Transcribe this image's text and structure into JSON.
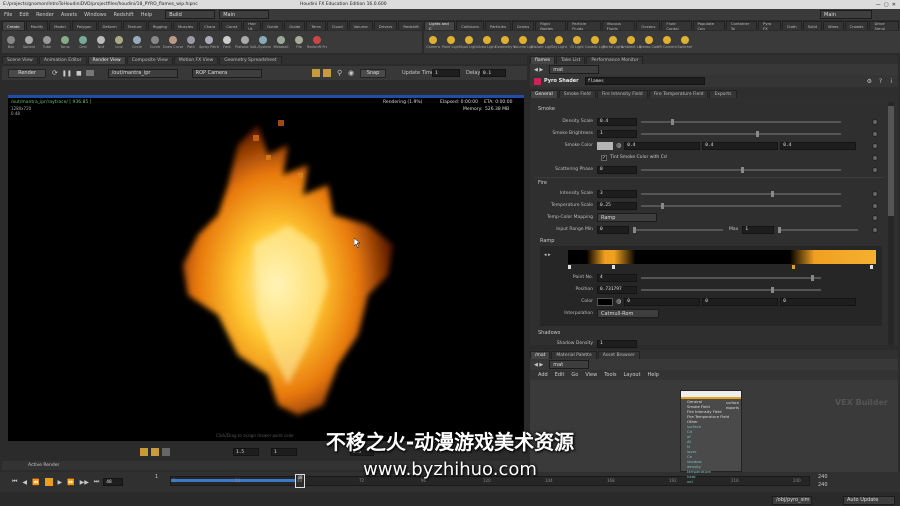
{
  "titlebar": {
    "path": "E:/projects/gnomon/IntroToHoudiniDVD/projectfiles/houdini/18_PYRO_flames_wip.hipnc",
    "app": "Houdini FX Education Edition 16.0.600"
  },
  "menubar": {
    "items": [
      "File",
      "Edit",
      "Render",
      "Assets",
      "Windows",
      "Redshift",
      "Help"
    ],
    "desktop": "Build",
    "context": "Main",
    "right_desktop": "Main"
  },
  "shelf_tabs_left": [
    "Create",
    "Modify",
    "Model",
    "Polygon",
    "Deform",
    "Texture",
    "Rigging",
    "Muscles",
    "Chara",
    "Const",
    "Hair Ut",
    "Guide",
    "Guide",
    "Terra",
    "Cloud",
    "Volume",
    "Drivers",
    "Redshift"
  ],
  "shelf_tools_left": [
    "Box",
    "Sphere",
    "Tube",
    "Torus",
    "Grid",
    "Null",
    "Line",
    "Circle",
    "Curve",
    "Draw Curve",
    "Path",
    "Spray Paint",
    "Font",
    "Platonic Solids",
    "L-System",
    "Metaball",
    "File",
    "Redshift Proxy"
  ],
  "shelf_tabs_right": [
    "Lights and C",
    "Collisions",
    "Particles",
    "Grains",
    "Rigid Bodies",
    "Particle Fluids",
    "Viscous Fluids",
    "Oceans",
    "Fluid Contai",
    "Populate Con",
    "Container To",
    "Pyro FX",
    "Cloth",
    "Solid",
    "Wires",
    "Crowds",
    "Drive Simul"
  ],
  "shelf_tools_right": [
    "Camera",
    "Point Light",
    "Spot Light",
    "Area Light",
    "Geometry Light",
    "Volume Light",
    "Distant Light",
    "Sky Light",
    "GI Light",
    "Caustic Light",
    "Portal Light",
    "Ambient Light",
    "Stereo Camera",
    "VR Camera",
    "Switcher"
  ],
  "viewer": {
    "tabs": [
      "Scene View",
      "Animation Editor",
      "Render View",
      "Composite View",
      "Motion FX View",
      "Geometry Spreadsheet"
    ],
    "render_btn": "Render",
    "out_path": "/out/mantra_ipr",
    "camera": "ROP Camera",
    "snapshot": "Snap",
    "update_time_label": "Update Time",
    "update_time": "1",
    "delay_label": "Delay",
    "delay": "0.1",
    "node_path": "/out/mantra_ipr/raytrace/ [ 936.85 ]",
    "resolution": "1280x720",
    "zoom": "0.48",
    "status": "Rendering (1.9%)",
    "elapsed": "Elapsed: 0:00:00",
    "eta": "ETA: 0:00:00",
    "memory_label": "Memory:",
    "memory": "526.38 MB",
    "hint": "Click/Drag to assign drawer point color",
    "frame_val": "1.5",
    "frame2": "1",
    "val3": "0.5"
  },
  "timeline": {
    "frame": "48",
    "start": "1",
    "end": "240",
    "end2": "240",
    "ticks": [
      "1",
      "24",
      "48",
      "72",
      "96",
      "120",
      "144",
      "168",
      "192",
      "216",
      "240"
    ]
  },
  "statusbar": {
    "left": "Active Render",
    "path": "/obj/pyro_sim",
    "update": "Auto Update"
  },
  "panel": {
    "tabs": [
      "flames",
      "Take List",
      "Performance Monitor"
    ],
    "net_path": "mat",
    "node_type": "Pyro Shader",
    "node_name": "flames",
    "param_tabs": [
      "General",
      "Smoke Field",
      "Fire Intensity Field",
      "Fire Temperature Field",
      "Exports"
    ],
    "smoke_section": "Smoke",
    "density_label": "Density Scale",
    "density": "0.4",
    "smoke_bright_label": "Smoke Brightness",
    "smoke_bright": "1",
    "smoke_color_label": "Smoke Color",
    "smoke_color": [
      "0.4",
      "0.4",
      "0.4"
    ],
    "tint_label": "Tint Smoke Color with Cd",
    "scatter_label": "Scattering Phase",
    "scatter": "0",
    "fire_section": "Fire",
    "intensity_label": "Intensity Scale",
    "intensity": "3",
    "temp_label": "Temperature Scale",
    "temp": "0.25",
    "mapping_label": "Temp-Color Mapping",
    "mapping": "Ramp",
    "input_range_label": "Input Range Min",
    "input_min": "0",
    "max_label": "Max",
    "input_max": "1",
    "ramp_section": "Ramp",
    "point_no_label": "Point No.",
    "point_no": "4",
    "position_label": "Position",
    "position": "0.731797",
    "color_label": "Color",
    "color_vals": [
      "0",
      "0",
      "0"
    ],
    "interp_label": "Interpolation",
    "interp": "Catmull-Rom",
    "shadows_section": "Shadows",
    "shadow_density_label": "Shadow Density",
    "shadow_density": "1"
  },
  "network": {
    "tabs": [
      "/mat",
      "Material Palette",
      "Asset Browser"
    ],
    "path": "mat",
    "menu": [
      "Add",
      "Edit",
      "Go",
      "View",
      "Tools",
      "Layout",
      "Help"
    ],
    "watermark": "VEX Builder",
    "node_lines": [
      "General",
      "Smoke Field",
      "Fire Intensity Field",
      "Fire Temperature Field",
      "Other",
      "surface",
      "Cd",
      "of",
      "Af",
      "N",
      "layer",
      "Ce",
      "shadow",
      "density",
      "temperature",
      "heat",
      "vel"
    ],
    "node_out": [
      "surface",
      "exports"
    ]
  },
  "overlay": {
    "cn": "不移之火-动漫游戏美术资源",
    "url": "www.byzhihuo.com"
  },
  "colors": {
    "accent": "#e8a020",
    "panel": "#2f2f2f",
    "field": "#1e1e1e"
  }
}
